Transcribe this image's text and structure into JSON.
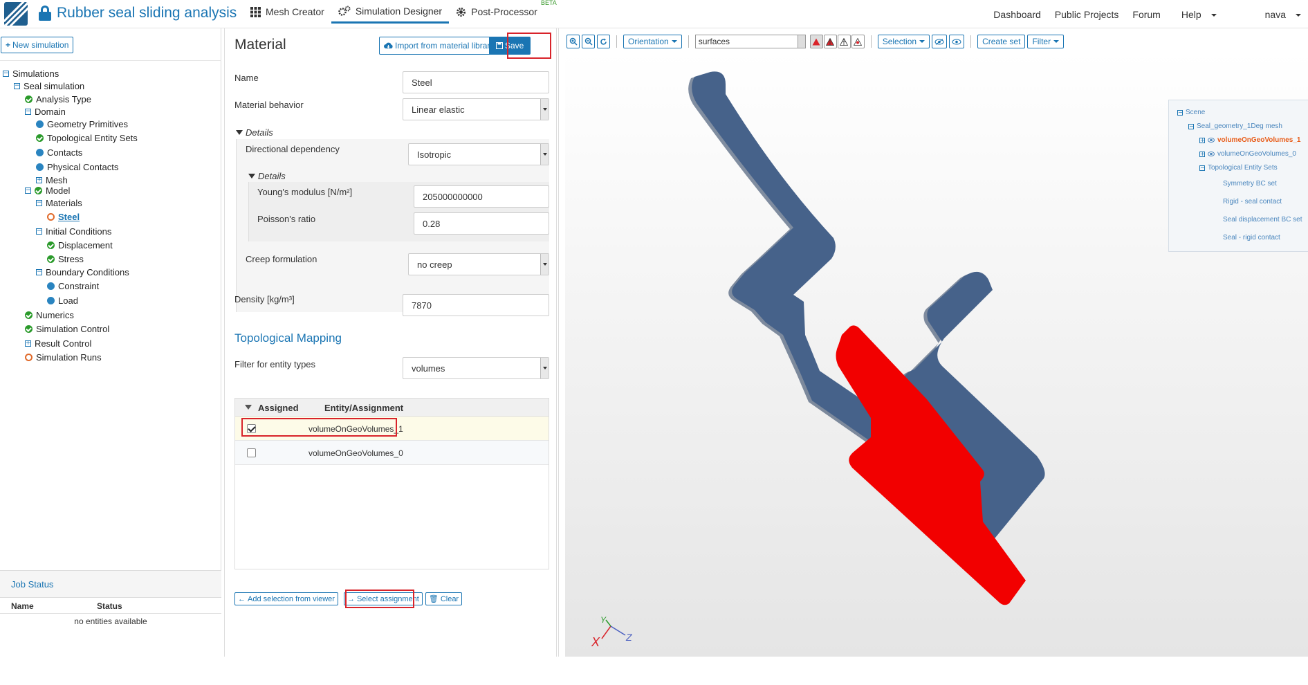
{
  "app": {
    "title": "Rubber seal sliding analysis",
    "nav_tabs": [
      {
        "label": "Mesh Creator",
        "icon": "grid-icon"
      },
      {
        "label": "Simulation Designer",
        "icon": "gears-icon"
      },
      {
        "label": "Post-Processor",
        "icon": "gear-icon",
        "badge": "BETA"
      }
    ],
    "right_nav": {
      "dashboard": "Dashboard",
      "public_projects": "Public Projects",
      "forum": "Forum",
      "help": "Help",
      "user": "nava"
    },
    "accent_color": "#1a75b3"
  },
  "sidebar": {
    "new_simulation": "New simulation",
    "tree": {
      "simulations": "Simulations",
      "seal_simulation": "Seal simulation",
      "analysis_type": "Analysis Type",
      "domain": "Domain",
      "geometry_primitives": "Geometry Primitives",
      "topological_entity_sets": "Topological Entity Sets",
      "contacts": "Contacts",
      "physical_contacts": "Physical Contacts",
      "mesh": "Mesh",
      "model": "Model",
      "materials": "Materials",
      "steel": "Steel",
      "initial_conditions": "Initial Conditions",
      "displacement": "Displacement",
      "stress": "Stress",
      "boundary_conditions": "Boundary Conditions",
      "constraint": "Constraint",
      "load": "Load",
      "numerics": "Numerics",
      "simulation_control": "Simulation Control",
      "result_control": "Result Control",
      "simulation_runs": "Simulation Runs"
    },
    "job_status": {
      "title": "Job Status",
      "col_name": "Name",
      "col_status": "Status",
      "empty": "no entities available"
    }
  },
  "material": {
    "title": "Material",
    "import_label": "Import from material library",
    "save_label": "Save",
    "name_label": "Name",
    "name_value": "Steel",
    "behavior_label": "Material behavior",
    "behavior_value": "Linear elastic",
    "details_label": "Details",
    "directional_label": "Directional dependency",
    "directional_value": "Isotropic",
    "details2_label": "Details",
    "youngs_label": "Young's modulus [N/m²]",
    "youngs_value": "205000000000",
    "poisson_label": "Poisson's ratio",
    "poisson_value": "0.28",
    "creep_label": "Creep formulation",
    "creep_value": "no creep",
    "density_label": "Density [kg/m³]",
    "density_value": "7870"
  },
  "mapping": {
    "title": "Topological Mapping",
    "filter_label": "Filter for entity types",
    "filter_value": "volumes",
    "col_assigned": "Assigned",
    "col_entity": "Entity/Assignment",
    "rows": [
      {
        "entity": "volumeOnGeoVolumes_1",
        "assigned": true
      },
      {
        "entity": "volumeOnGeoVolumes_0",
        "assigned": false
      }
    ],
    "add_selection": "Add selection from viewer",
    "select_assignment": "Select assignment",
    "clear": "Clear"
  },
  "viewer": {
    "orientation": "Orientation",
    "surfaces": "surfaces",
    "selection": "Selection",
    "create_set": "Create set",
    "filter": "Filter",
    "seal_color": "#46628a",
    "selected_color": "#f20000",
    "scene_tree": {
      "scene": "Scene",
      "mesh": "Seal_geometry_1Deg mesh",
      "vol1": "volumeOnGeoVolumes_1",
      "vol0": "volumeOnGeoVolumes_0",
      "tes": "Topological Entity Sets",
      "set1": "Symmetry BC set",
      "set2": "Rigid - seal contact",
      "set3": "Seal displacement BC set",
      "set4": "Seal - rigid contact"
    },
    "axes": {
      "x": "X",
      "y": "Y",
      "z": "Z"
    }
  }
}
